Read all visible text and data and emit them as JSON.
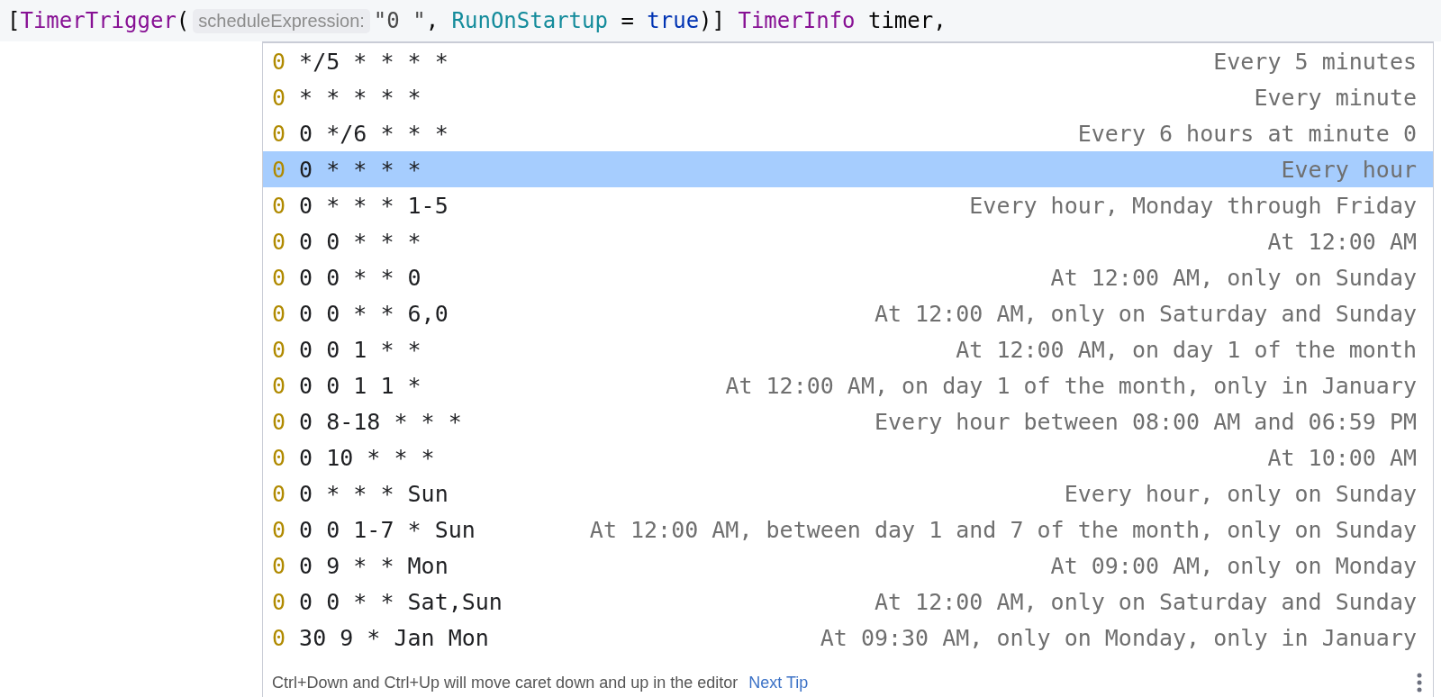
{
  "code_line": [
    {
      "kind": "punct",
      "text": "["
    },
    {
      "kind": "type",
      "text": "TimerTrigger"
    },
    {
      "kind": "punct",
      "text": "("
    },
    {
      "kind": "hint",
      "text": "scheduleExpression:"
    },
    {
      "kind": "string",
      "text": "\"0 \""
    },
    {
      "kind": "punct",
      "text": ", "
    },
    {
      "kind": "param",
      "text": "RunOnStartup"
    },
    {
      "kind": "punct",
      "text": " = "
    },
    {
      "kind": "keyword",
      "text": "true"
    },
    {
      "kind": "punct",
      "text": ")] "
    },
    {
      "kind": "type",
      "text": "TimerInfo"
    },
    {
      "kind": "punct",
      "text": " timer,"
    }
  ],
  "completion": {
    "items": [
      {
        "matched": "0",
        "expression": "*/5 * * * *",
        "description": "Every 5 minutes",
        "selected": false
      },
      {
        "matched": "0",
        "expression": "* * * * *",
        "description": "Every minute",
        "selected": false
      },
      {
        "matched": "0",
        "expression": "0 */6 * * *",
        "description": "Every 6 hours at minute 0",
        "selected": false
      },
      {
        "matched": "0",
        "expression": "0 * * * *",
        "description": "Every hour",
        "selected": true
      },
      {
        "matched": "0",
        "expression": "0 * * * 1-5",
        "description": "Every hour, Monday through Friday",
        "selected": false
      },
      {
        "matched": "0",
        "expression": "0 0 * * *",
        "description": "At 12:00 AM",
        "selected": false
      },
      {
        "matched": "0",
        "expression": "0 0 * * 0",
        "description": "At 12:00 AM, only on Sunday",
        "selected": false
      },
      {
        "matched": "0",
        "expression": "0 0 * * 6,0",
        "description": "At 12:00 AM, only on Saturday and Sunday",
        "selected": false
      },
      {
        "matched": "0",
        "expression": "0 0 1 * *",
        "description": "At 12:00 AM, on day 1 of the month",
        "selected": false
      },
      {
        "matched": "0",
        "expression": "0 0 1 1 *",
        "description": "At 12:00 AM, on day 1 of the month, only in January",
        "selected": false
      },
      {
        "matched": "0",
        "expression": "0 8-18 * * *",
        "description": "Every hour between 08:00 AM and 06:59 PM",
        "selected": false
      },
      {
        "matched": "0",
        "expression": "0 10 * * *",
        "description": "At 10:00 AM",
        "selected": false
      },
      {
        "matched": "0",
        "expression": "0 * * * Sun",
        "description": "Every hour, only on Sunday",
        "selected": false
      },
      {
        "matched": "0",
        "expression": "0 0 1-7 * Sun",
        "description": "At 12:00 AM, between day 1 and 7 of the month, only on Sunday",
        "selected": false
      },
      {
        "matched": "0",
        "expression": "0 9 * * Mon",
        "description": "At 09:00 AM, only on Monday",
        "selected": false
      },
      {
        "matched": "0",
        "expression": "0 0 * * Sat,Sun",
        "description": "At 12:00 AM, only on Saturday and Sunday",
        "selected": false
      },
      {
        "matched": "0",
        "expression": "30 9 * Jan Mon",
        "description": "At 09:30 AM, only on Monday, only in January",
        "selected": false
      }
    ],
    "footer": {
      "tip": "Ctrl+Down and Ctrl+Up will move caret down and up in the editor",
      "link": "Next Tip"
    }
  }
}
